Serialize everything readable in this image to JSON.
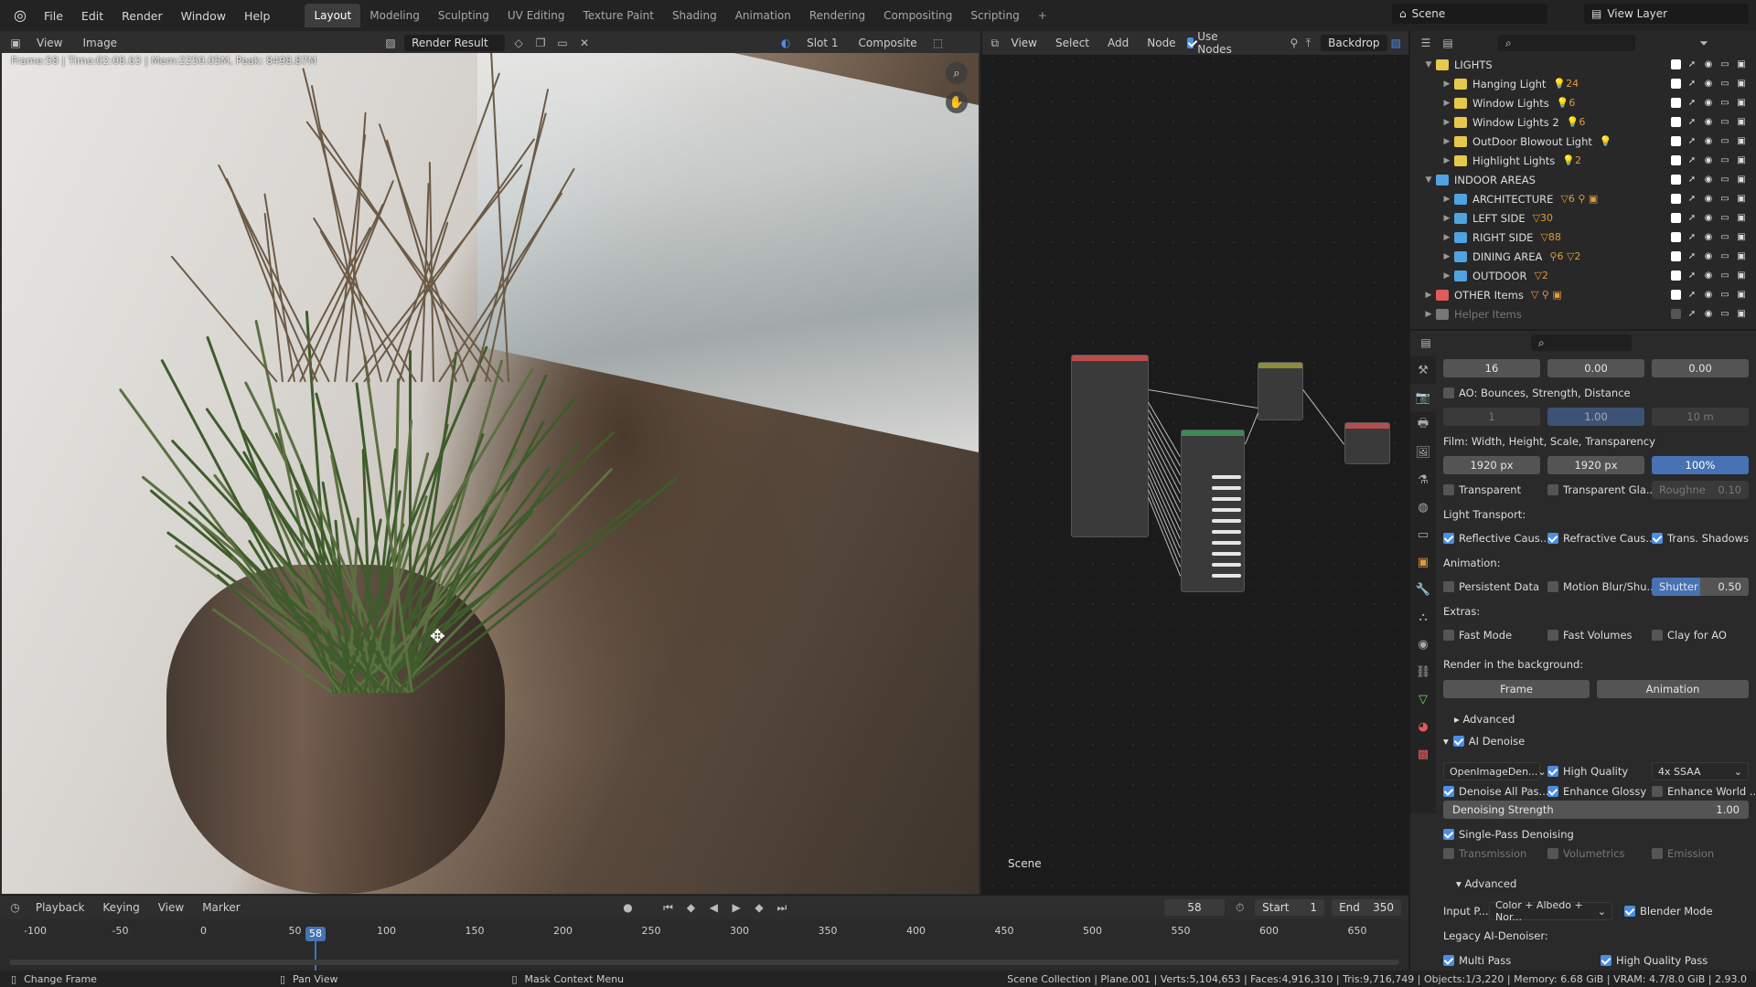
{
  "app": {
    "logo_icon": "blender-logo-icon"
  },
  "topbar": {
    "menus": [
      "File",
      "Edit",
      "Render",
      "Window",
      "Help"
    ],
    "workspaces": [
      "Layout",
      "Modeling",
      "Sculpting",
      "UV Editing",
      "Texture Paint",
      "Shading",
      "Animation",
      "Rendering",
      "Compositing",
      "Scripting"
    ],
    "active_workspace": "Layout",
    "add_workspace": "+",
    "scene": "Scene",
    "view_layer": "View Layer"
  },
  "image_editor": {
    "menus": [
      "View",
      "Image"
    ],
    "image_name": "Render Result",
    "slot": "Slot 1",
    "layer": "Composite",
    "overlay": "Frame:58 | Time:02:08.63 | Mem:2250.05M, Peak: 8498.87M"
  },
  "node_editor": {
    "menus": [
      "View",
      "Select",
      "Add",
      "Node"
    ],
    "use_nodes_label": "Use Nodes",
    "use_nodes": true,
    "backdrop_label": "Backdrop",
    "scene_label": "Scene"
  },
  "outliner": {
    "rows": [
      {
        "name": "LIGHTS",
        "depth": 0,
        "color": "#e6c84a",
        "expanded": true,
        "mods": "",
        "enabled": true
      },
      {
        "name": "Hanging Light",
        "depth": 1,
        "color": "#e6c84a",
        "expanded": false,
        "mods": "💡24",
        "enabled": true
      },
      {
        "name": "Window Lights",
        "depth": 1,
        "color": "#e6c84a",
        "expanded": false,
        "mods": "💡6",
        "enabled": true
      },
      {
        "name": "Window Lights 2",
        "depth": 1,
        "color": "#e6c84a",
        "expanded": false,
        "mods": "💡6",
        "enabled": true
      },
      {
        "name": "OutDoor Blowout Light",
        "depth": 1,
        "color": "#e6c84a",
        "expanded": false,
        "mods": "💡",
        "enabled": true
      },
      {
        "name": "Highlight Lights",
        "depth": 1,
        "color": "#e6c84a",
        "expanded": false,
        "mods": "💡2",
        "enabled": true
      },
      {
        "name": "INDOOR AREAS",
        "depth": 0,
        "color": "#4fa3e0",
        "expanded": true,
        "mods": "",
        "enabled": true
      },
      {
        "name": "ARCHITECTURE",
        "depth": 1,
        "color": "#4fa3e0",
        "expanded": false,
        "mods": "▽6 ⚲ ▣",
        "enabled": true
      },
      {
        "name": "LEFT SIDE",
        "depth": 1,
        "color": "#4fa3e0",
        "expanded": false,
        "mods": "▽30",
        "enabled": true
      },
      {
        "name": "RIGHT SIDE",
        "depth": 1,
        "color": "#4fa3e0",
        "expanded": false,
        "mods": "▽88",
        "enabled": true
      },
      {
        "name": "DINING AREA",
        "depth": 1,
        "color": "#4fa3e0",
        "expanded": false,
        "mods": "⚲6 ▽2",
        "enabled": true
      },
      {
        "name": "OUTDOOR",
        "depth": 1,
        "color": "#4fa3e0",
        "expanded": false,
        "mods": "▽2",
        "enabled": true
      },
      {
        "name": "OTHER Items",
        "depth": 0,
        "color": "#e05a5a",
        "expanded": false,
        "mods": "▽ ⚲ ▣",
        "enabled": true
      },
      {
        "name": "Helper Items",
        "depth": 0,
        "color": "#777777",
        "expanded": false,
        "mods": "",
        "enabled": false
      }
    ]
  },
  "properties": {
    "row1": [
      "16",
      "0.00",
      "0.00"
    ],
    "ao_label": "AO: Bounces, Strength, Distance",
    "row2": [
      "1",
      "1.00",
      "10 m"
    ],
    "film_label": "Film: Width, Height, Scale, Transparency",
    "film": [
      "1920 px",
      "1920 px",
      "100%"
    ],
    "transparent": "Transparent",
    "transparent_glass": "Transparent Gla...",
    "roughness_label": "Roughne",
    "roughness": "0.10",
    "light_transport": "Light Transport:",
    "reflective": "Reflective Caus...",
    "refractive": "Refractive Caus...",
    "trans_shadows": "Trans. Shadows",
    "animation": "Animation:",
    "persistent": "Persistent Data",
    "motion_blur": "Motion Blur/Shu...",
    "shutter_label": "Shutter",
    "shutter": "0.50",
    "extras": "Extras:",
    "fast_mode": "Fast Mode",
    "fast_volumes": "Fast Volumes",
    "clay": "Clay for AO",
    "render_bg": "Render in the background:",
    "frame_btn": "Frame",
    "anim_btn": "Animation",
    "advanced": "Advanced",
    "ai_denoise": "AI Denoise",
    "denoiser": "OpenImageDen...",
    "high_quality": "High Quality",
    "ssaa": "4x SSAA",
    "denoise_all": "Denoise All Pas...",
    "enhance_glossy": "Enhance Glossy",
    "enhance_world": "Enhance World ...",
    "denoise_strength_label": "Denoising Strength",
    "denoise_strength": "1.00",
    "single_pass": "Single-Pass Denoising",
    "transmission": "Transmission",
    "volumetrics": "Volumetrics",
    "emission": "Emission",
    "advanced2": "Advanced",
    "input_label": "Input P...",
    "input_value": "Color + Albedo + Nor...",
    "blender_mode": "Blender Mode",
    "legacy": "Legacy AI-Denoiser:",
    "multi_pass": "Multi Pass",
    "hq_pass": "High Quality Pass"
  },
  "timeline": {
    "menus": [
      "Playback",
      "Keying",
      "View",
      "Marker"
    ],
    "current_frame": "58",
    "start_label": "Start",
    "start": "1",
    "end_label": "End",
    "end": "350",
    "ticks": [
      "-100",
      "-50",
      "0",
      "50",
      "100",
      "150",
      "200",
      "250",
      "300",
      "350",
      "400",
      "450",
      "500",
      "550",
      "600",
      "650"
    ],
    "playhead": "58"
  },
  "status": {
    "left1": "Change Frame",
    "left2": "Pan View",
    "left3": "Mask Context Menu",
    "right": "Scene Collection | Plane.001 | Verts:5,104,653 | Faces:4,916,310 | Tris:9,716,749 | Objects:1/3,220 | Memory: 6.68 GiB | VRAM: 4.7/8.0 GiB | 2.93.0"
  }
}
